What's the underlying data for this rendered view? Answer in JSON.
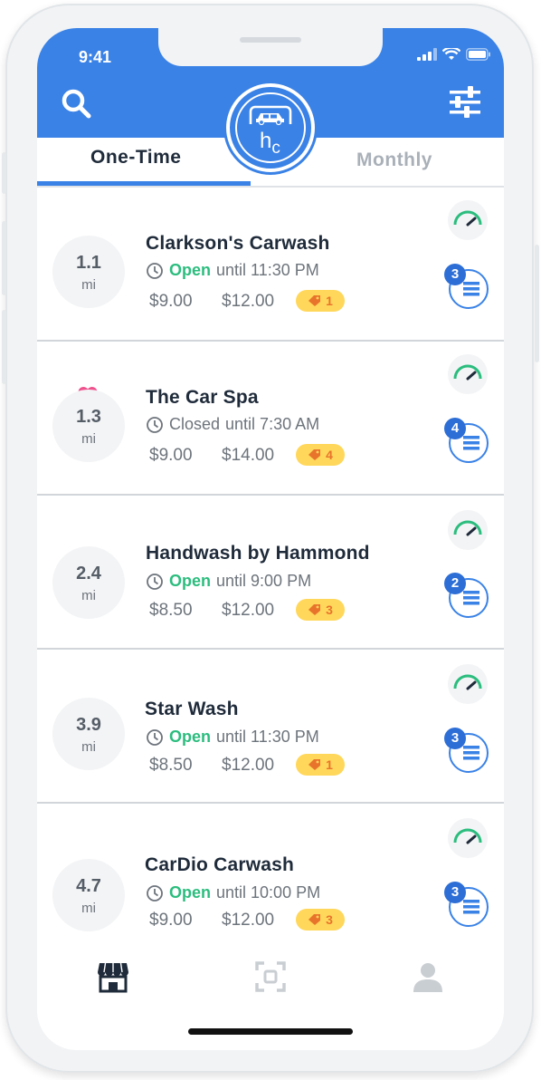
{
  "status_bar": {
    "time": "9:41"
  },
  "header": {
    "logo_text": "h",
    "logo_sub": "c"
  },
  "tabs": [
    {
      "label": "One-Time",
      "active": true
    },
    {
      "label": "Monthly",
      "active": false
    }
  ],
  "listings": [
    {
      "name": "Clarkson's Carwash",
      "distance": "1.1",
      "unit": "mi",
      "status": "Open",
      "until": "until 11:30 PM",
      "price1": "$9.00",
      "price2": "$12.00",
      "deals": "1",
      "queue": "3",
      "favorite": false
    },
    {
      "name": "The Car Spa",
      "distance": "1.3",
      "unit": "mi",
      "status": "Closed",
      "until": "until 7:30 AM",
      "price1": "$9.00",
      "price2": "$14.00",
      "deals": "4",
      "queue": "4",
      "favorite": true
    },
    {
      "name": "Handwash by Hammond",
      "distance": "2.4",
      "unit": "mi",
      "status": "Open",
      "until": "until 9:00 PM",
      "price1": "$8.50",
      "price2": "$12.00",
      "deals": "3",
      "queue": "2",
      "favorite": false
    },
    {
      "name": "Star Wash",
      "distance": "3.9",
      "unit": "mi",
      "status": "Open",
      "until": "until 11:30 PM",
      "price1": "$8.50",
      "price2": "$12.00",
      "deals": "1",
      "queue": "3",
      "favorite": false
    },
    {
      "name": "CarDio Carwash",
      "distance": "4.7",
      "unit": "mi",
      "status": "Open",
      "until": "until 10:00 PM",
      "price1": "$9.00",
      "price2": "$12.00",
      "deals": "3",
      "queue": "3",
      "favorite": false
    }
  ],
  "bottom_nav": {
    "items": [
      {
        "icon": "storefront-icon",
        "active": true
      },
      {
        "icon": "scan-icon",
        "active": false
      },
      {
        "icon": "profile-icon",
        "active": false
      }
    ]
  },
  "colors": {
    "brand_blue": "#3a82e6",
    "open_green": "#2bbd7e",
    "deal_yellow": "#ffd75a",
    "favorite_pink": "#f0508c"
  }
}
